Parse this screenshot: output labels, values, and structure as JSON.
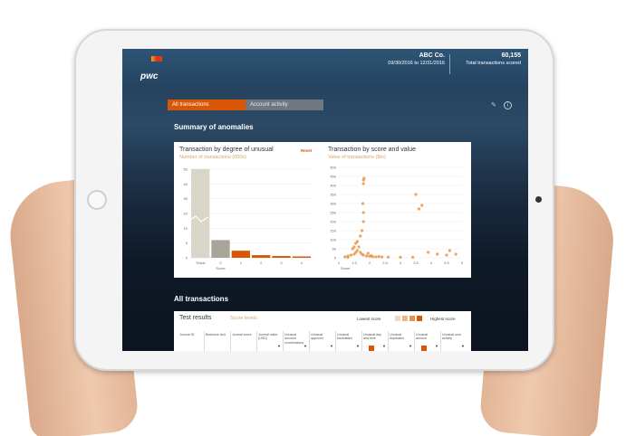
{
  "header": {
    "logo": "pwc",
    "company_name": "ABC Co.",
    "date_range": "09/30/2016 to 12/31/2016",
    "total_count": "60,155",
    "total_label": "Total transactions scored"
  },
  "tabs": [
    {
      "label": "All transactions",
      "active": true
    },
    {
      "label": "Account activity",
      "active": false
    }
  ],
  "summary_title": "Summary of anomalies",
  "chart_left": {
    "title": "Transaction by degree of unusual",
    "subtitle": "Number of transactions (000s)",
    "reset_label": "Reset"
  },
  "chart_right": {
    "title": "Transaction by score and value",
    "subtitle": "Value of transactions ($m)"
  },
  "chart_data": [
    {
      "type": "bar",
      "categories": [
        "Trivial",
        "0",
        "1",
        "2",
        "3",
        "4"
      ],
      "values": [
        50,
        10,
        4,
        1.5,
        1,
        0.5
      ],
      "xlabel": "Score",
      "ylim": [
        0,
        50
      ],
      "yticks": [
        "0",
        "5",
        "10",
        "20",
        "30",
        "40",
        "50"
      ],
      "colors": [
        "#d9d6c9",
        "#a8a499",
        "#d85604",
        "#d85604",
        "#d85604",
        "#d85604"
      ]
    },
    {
      "type": "scatter",
      "xlabel": "Score",
      "xlim": [
        1,
        5
      ],
      "ylim": [
        0,
        500
      ],
      "xticks": [
        "1",
        "1.5",
        "2",
        "2.5",
        "3",
        "3.5",
        "4",
        "4.5",
        "5"
      ],
      "yticks": [
        "0",
        "50",
        "100",
        "150",
        "200",
        "250",
        "300",
        "350",
        "400",
        "450",
        "500"
      ],
      "points": [
        [
          1.2,
          5
        ],
        [
          1.3,
          10
        ],
        [
          1.4,
          15
        ],
        [
          1.5,
          20
        ],
        [
          1.55,
          30
        ],
        [
          1.6,
          40
        ],
        [
          1.65,
          60
        ],
        [
          1.7,
          30
        ],
        [
          1.75,
          20
        ],
        [
          1.8,
          15
        ],
        [
          1.9,
          10
        ],
        [
          2.0,
          8
        ],
        [
          2.1,
          6
        ],
        [
          2.2,
          5
        ],
        [
          1.5,
          60
        ],
        [
          1.6,
          90
        ],
        [
          1.7,
          120
        ],
        [
          1.75,
          150
        ],
        [
          1.8,
          200
        ],
        [
          1.8,
          250
        ],
        [
          1.78,
          300
        ],
        [
          1.8,
          430
        ],
        [
          1.82,
          440
        ],
        [
          1.8,
          410
        ],
        [
          2.4,
          5
        ],
        [
          2.6,
          4
        ],
        [
          3.0,
          3
        ],
        [
          3.4,
          3
        ],
        [
          3.5,
          350
        ],
        [
          3.6,
          270
        ],
        [
          3.7,
          290
        ],
        [
          3.9,
          30
        ],
        [
          4.2,
          20
        ],
        [
          4.5,
          15
        ],
        [
          4.6,
          40
        ],
        [
          4.8,
          20
        ],
        [
          1.3,
          3
        ],
        [
          1.45,
          50
        ],
        [
          1.55,
          80
        ],
        [
          1.95,
          25
        ],
        [
          2.05,
          12
        ],
        [
          2.3,
          7
        ]
      ],
      "color": "#e8944a"
    }
  ],
  "all_transactions_title": "All transactions",
  "table": {
    "title": "Test results",
    "score_levels_label": "Score levels",
    "lowest_label": "Lowest score",
    "highest_label": "Highest score",
    "columns": [
      "Journal ID",
      "Business Unit",
      "Journal score",
      "Journal value (USD)",
      "Unusual account combinations",
      "Unusual approver",
      "Unusual backdated",
      "Unusual day and time",
      "Unusual duplicates",
      "Unusual amount",
      "Unusual user activity"
    ],
    "legend_colors": [
      "#f3d9bf",
      "#ebb98a",
      "#e2934f",
      "#d85604"
    ]
  }
}
